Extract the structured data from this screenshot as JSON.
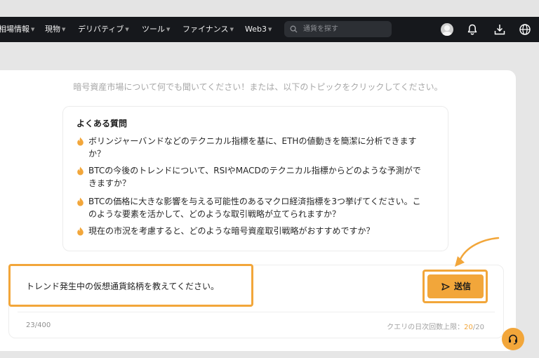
{
  "nav": {
    "items": [
      {
        "label": "相場情報"
      },
      {
        "label": "現物"
      },
      {
        "label": "デリバティブ"
      },
      {
        "label": "ツール"
      },
      {
        "label": "ファイナンス"
      },
      {
        "label": "Web3"
      }
    ],
    "search_placeholder": "通貨を探す"
  },
  "chat": {
    "intro": "暗号資産市場について何でも聞いてください！または、以下のトピックをクリックしてください。",
    "faq_title": "よくある質問",
    "faq": [
      "ボリンジャーバンドなどのテクニカル指標を基に、ETHの値動きを簡潔に分析できますか？",
      "BTCの今後のトレンドについて、RSIやMACDのテクニカル指標からどのような予測ができますか？",
      "BTCの価格に大きな影響を与える可能性のあるマクロ経済指標を3つ挙げてください。このような要素を活かして、どのような取引戦略が立てられますか？",
      "現在の市況を考慮すると、どのような暗号資産取引戦略がおすすめですか？"
    ],
    "query": "トレンド発生中の仮想通貨銘柄を教えてください。",
    "char_count": "23/400",
    "limit_label": "クエリの日次回数上限：",
    "limit_used": "20",
    "limit_total": "/20",
    "send_label": "送信"
  },
  "colors": {
    "accent": "#f2a63a",
    "navbar": "#16181c"
  },
  "icons": [
    "search-icon",
    "avatar",
    "bell-icon",
    "download-icon",
    "globe-icon",
    "fire-icon",
    "send-icon",
    "headset-icon"
  ]
}
